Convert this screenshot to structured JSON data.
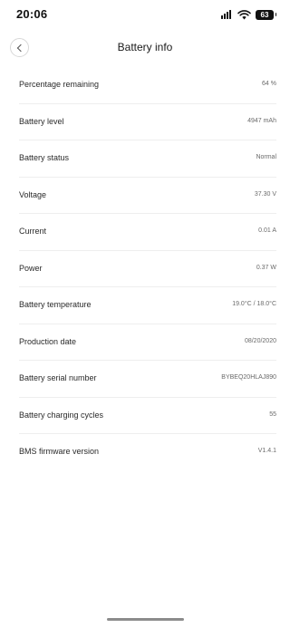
{
  "status_bar": {
    "time": "20:06",
    "battery_level": "63",
    "icons": [
      "signal-icon",
      "wifi-icon",
      "battery-icon"
    ]
  },
  "header": {
    "title": "Battery info",
    "back_icon": "chevron-left-icon"
  },
  "rows": [
    {
      "label": "Percentage remaining",
      "value": "64 %"
    },
    {
      "label": "Battery level",
      "value": "4947 mAh"
    },
    {
      "label": "Battery status",
      "value": "Normal"
    },
    {
      "label": "Voltage",
      "value": "37.30 V"
    },
    {
      "label": "Current",
      "value": "0.01 A"
    },
    {
      "label": "Power",
      "value": "0.37 W"
    },
    {
      "label": "Battery temperature",
      "value": "19.0°C / 18.0°C"
    },
    {
      "label": "Production date",
      "value": "08/20/2020"
    },
    {
      "label": "Battery serial number",
      "value": "BYBEQ20HLAJ890"
    },
    {
      "label": "Battery charging cycles",
      "value": "55"
    },
    {
      "label": "BMS firmware version",
      "value": "V1.4.1"
    }
  ]
}
